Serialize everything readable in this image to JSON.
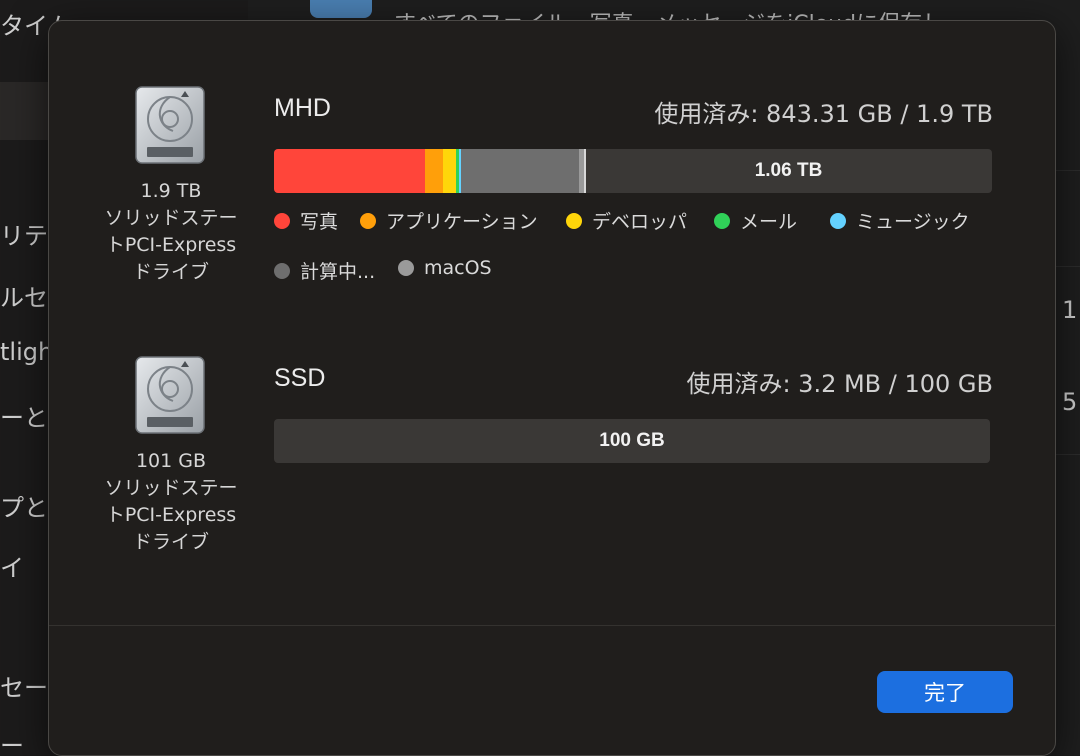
{
  "background": {
    "sidebar_fragments": [
      "タイム",
      "リテ",
      "ルセ",
      "tligh",
      "ーと",
      "プと",
      "イ",
      "セー",
      "ー"
    ],
    "right_fragments": [
      "1",
      "5"
    ],
    "top_fragment": "すべてのファイル、写真、メッセージをiCloudに保存し"
  },
  "dialog": {
    "volumes": [
      {
        "name": "MHD",
        "usage": "使用済み: 843.31 GB / 1.9 TB",
        "capacity": "1.9 TB",
        "type_line1": "ソリッドステー",
        "type_line2": "トPCI-Express",
        "type_line3": "ドライブ",
        "free_label": "1.06 TB",
        "icon": "hard-drive-icon",
        "segments": [
          {
            "name": "写真",
            "color": "#ff453a",
            "fraction": 0.21
          },
          {
            "name": "アプリケーション",
            "color": "#ff9f0a",
            "fraction": 0.025
          },
          {
            "name": "デベロッパ",
            "color": "#ffd60a",
            "fraction": 0.018
          },
          {
            "name": "メール",
            "color": "#30d158",
            "fraction": 0.004
          },
          {
            "name": "ミュージック",
            "color": "#64d2ff",
            "fraction": 0.003
          },
          {
            "name": "計算中...",
            "color": "#6e6e6e",
            "fraction": 0.165
          },
          {
            "name": "macOS",
            "color": "#9a9a9a",
            "fraction": 0.008
          }
        ],
        "legend": [
          {
            "label": "写真",
            "color": "#ff453a"
          },
          {
            "label": "アプリケーション",
            "color": "#ff9f0a"
          },
          {
            "label": "デベロッパ",
            "color": "#ffd60a"
          },
          {
            "label": "メール",
            "color": "#30d158"
          },
          {
            "label": "ミュージック",
            "color": "#64d2ff"
          },
          {
            "label": "計算中...",
            "color": "#6e6e6e"
          },
          {
            "label": "macOS",
            "color": "#9a9a9a"
          }
        ]
      },
      {
        "name": "SSD",
        "usage": "使用済み: 3.2 MB / 100 GB",
        "capacity": "101 GB",
        "type_line1": "ソリッドステー",
        "type_line2": "トPCI-Express",
        "type_line3": "ドライブ",
        "free_label": "100 GB",
        "icon": "hard-drive-icon"
      }
    ],
    "done_button": "完了"
  },
  "colors": {
    "accent": "#1c6fe0",
    "dialog_bg": "#201e1c"
  }
}
